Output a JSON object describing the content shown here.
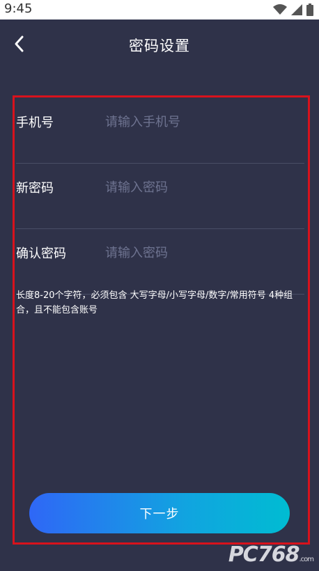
{
  "status_bar": {
    "time": "9:45"
  },
  "header": {
    "title": "密码设置",
    "back_icon": "chevron-left-icon"
  },
  "form": {
    "fields": [
      {
        "label": "手机号",
        "placeholder": "请输入手机号",
        "value": ""
      },
      {
        "label": "新密码",
        "placeholder": "请输入密码",
        "value": ""
      },
      {
        "label": "确认密码",
        "placeholder": "请输入密码",
        "value": ""
      }
    ],
    "hint": "长度8-20个字符，必须包含 大写字母/小写字母/数字/常用符号 4种组合，且不能包含账号"
  },
  "actions": {
    "next_label": "下一步"
  },
  "watermark": {
    "text": "PC768",
    "domain": ".com"
  },
  "colors": {
    "background": "#2f3249",
    "button_gradient_start": "#2f67f6",
    "button_gradient_end": "#00bcd2",
    "frame_border": "#d8121c"
  }
}
